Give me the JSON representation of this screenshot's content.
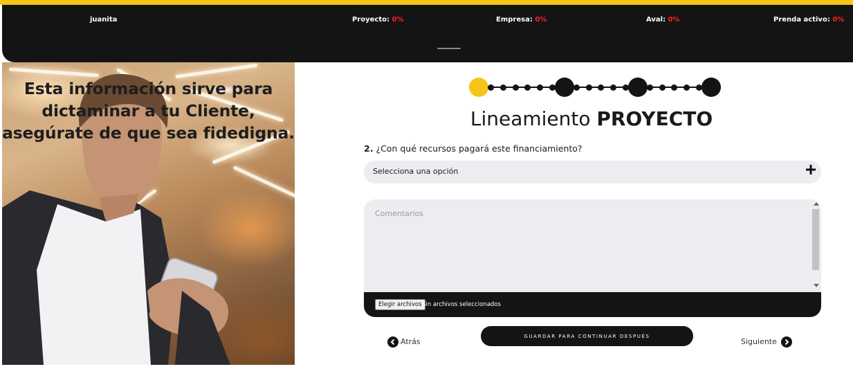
{
  "header": {
    "user": "juanita",
    "progress": [
      {
        "label": "Proyecto:",
        "value": "0%"
      },
      {
        "label": "Empresa:",
        "value": "0%"
      },
      {
        "label": "Aval:",
        "value": "0%"
      },
      {
        "label": "Prenda activo:",
        "value": "0%"
      }
    ]
  },
  "hero": {
    "caption": "Esta información sirve para dictaminar a tu Cliente, asegúrate de que sea fidedigna."
  },
  "stepper": {
    "current_step": 1,
    "total_steps": 20,
    "major_steps": [
      1,
      8,
      14,
      20
    ]
  },
  "form": {
    "title_light": "Lineamiento",
    "title_bold": "PROYECTO",
    "question_number": "2.",
    "question_text": "¿Con qué recursos pagará este financiamiento?",
    "select_placeholder": "Selecciona una opción",
    "comments_placeholder": "Comentarios",
    "file_button": "Elegir archivos",
    "file_status": "Sin archivos seleccionados"
  },
  "nav": {
    "back": "Atrás",
    "save": "GUARDAR PARA CONTINUAR DESPUÉS",
    "next": "Siguiente"
  },
  "colors": {
    "accent": "#f5c518",
    "dark": "#141414",
    "percent": "#ff2020",
    "field_bg": "#ededf1"
  }
}
